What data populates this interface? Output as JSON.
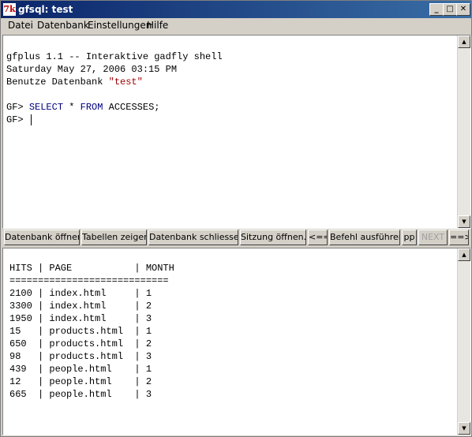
{
  "window": {
    "title": "gfsql: test",
    "app_icon": "tk-feather-icon"
  },
  "menu": [
    "Datei",
    "Datenbank",
    "Einstellungen",
    "Hilfe"
  ],
  "input_pane": {
    "banner": "gfplus 1.1 -- Interaktive gadfly shell",
    "date": "Saturday May 27, 2006 03:15 PM",
    "db_prefix": "Benutze Datenbank ",
    "db_name": "\"test\"",
    "prompt": "GF> ",
    "query_select": "SELECT",
    "query_star": " * ",
    "query_from": "FROM",
    "query_table": " ACCESSES;"
  },
  "buttons": [
    {
      "label": "Datenbank öffnen",
      "enabled": true
    },
    {
      "label": "Tabellen zeigen",
      "enabled": true
    },
    {
      "label": "Datenbank schliessen",
      "enabled": true
    },
    {
      "label": "Sitzung öffnen...",
      "enabled": true
    },
    {
      "label": "<==",
      "enabled": true
    },
    {
      "label": "Befehl ausführen",
      "enabled": true
    },
    {
      "label": "pp",
      "enabled": true
    },
    {
      "label": "NEXT",
      "enabled": false
    },
    {
      "label": "==>",
      "enabled": true
    }
  ],
  "results": {
    "header": "HITS | PAGE           | MONTH",
    "separator": "============================",
    "rows": [
      "2100 | index.html     | 1",
      "3300 | index.html     | 2",
      "1950 | index.html     | 3",
      "15   | products.html  | 1",
      "650  | products.html  | 2",
      "98   | products.html  | 3",
      "439  | people.html    | 1",
      "12   | people.html    | 2",
      "665  | people.html    | 3"
    ]
  }
}
